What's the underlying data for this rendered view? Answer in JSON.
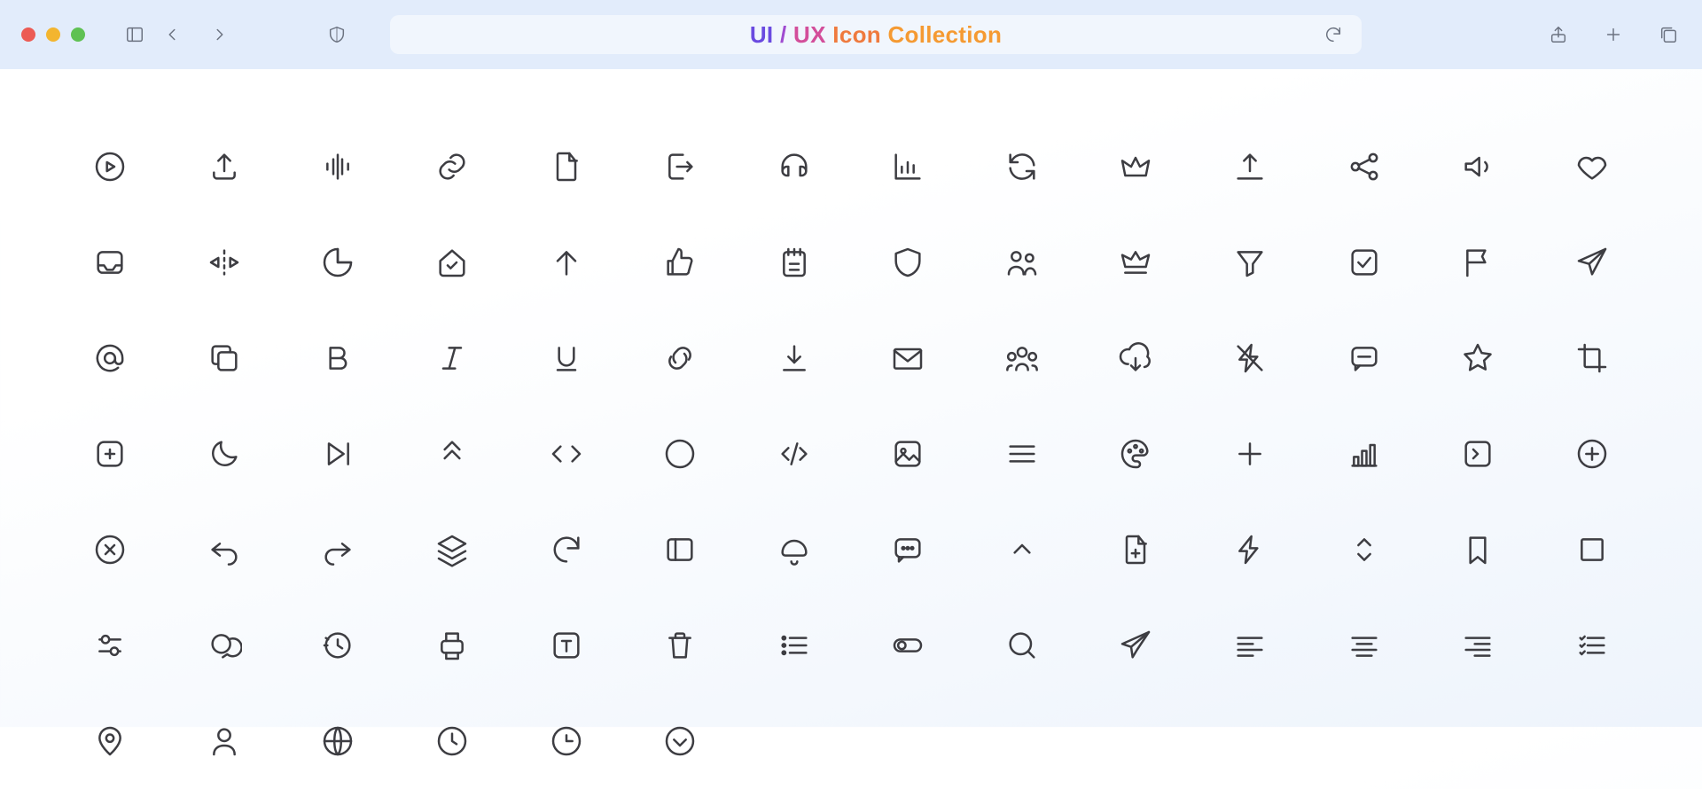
{
  "title": {
    "p1": "UI",
    "p2": " / ",
    "p3": "UX",
    "p4": " Icon ",
    "p5": "Collection"
  },
  "toolbar": {
    "close": "close",
    "minimize": "minimize",
    "zoom": "zoom",
    "sidebar": "sidebar",
    "back": "back",
    "forward": "forward",
    "shield": "privacy-shield",
    "reload": "reload",
    "share": "share",
    "new_tab": "new-tab",
    "tabs": "tab-overview"
  },
  "icons": [
    [
      "play-circle",
      "upload",
      "audio-waveform",
      "link",
      "file",
      "exit",
      "headphones",
      "bar-chart",
      "refresh",
      "crown",
      "upload-alt",
      "share-nodes",
      "volume",
      "heart",
      "inbox"
    ],
    [
      "mirror-horizontal",
      "pie-chart",
      "home-check",
      "arrow-up",
      "thumbs-up",
      "notepad",
      "shield",
      "users",
      "crown-underline",
      "funnel",
      "checkbox",
      "flag",
      "send",
      "at-sign",
      "copy"
    ],
    [
      "bold",
      "italic",
      "underline",
      "link-broken",
      "download",
      "mail",
      "group",
      "cloud-download",
      "flash-off",
      "message",
      "star",
      "crop",
      "add-square",
      "moon",
      "skip-forward"
    ],
    [
      "chevrons-up",
      "code",
      "circle",
      "code-slash",
      "image",
      "menu",
      "palette",
      "plus",
      "bar-chart-growth",
      "terminal",
      "plus-circle",
      "x-circle",
      "undo",
      "redo",
      "layers"
    ],
    [
      "rotate-cw",
      "sidebar-left",
      "bell",
      "message-dots",
      "chevron-up",
      "file-plus",
      "bolt",
      "sort-vertical",
      "bookmark",
      "stop",
      "sliders",
      "chat",
      "history",
      "printer",
      "text-box"
    ],
    [
      "trash",
      "list",
      "toggle",
      "search",
      "paper-plane",
      "align-left",
      "align-center",
      "align-right",
      "checklist",
      "map-pin",
      "user",
      "globe",
      "clock",
      "clock-alt",
      "chevron-down-circle"
    ]
  ]
}
